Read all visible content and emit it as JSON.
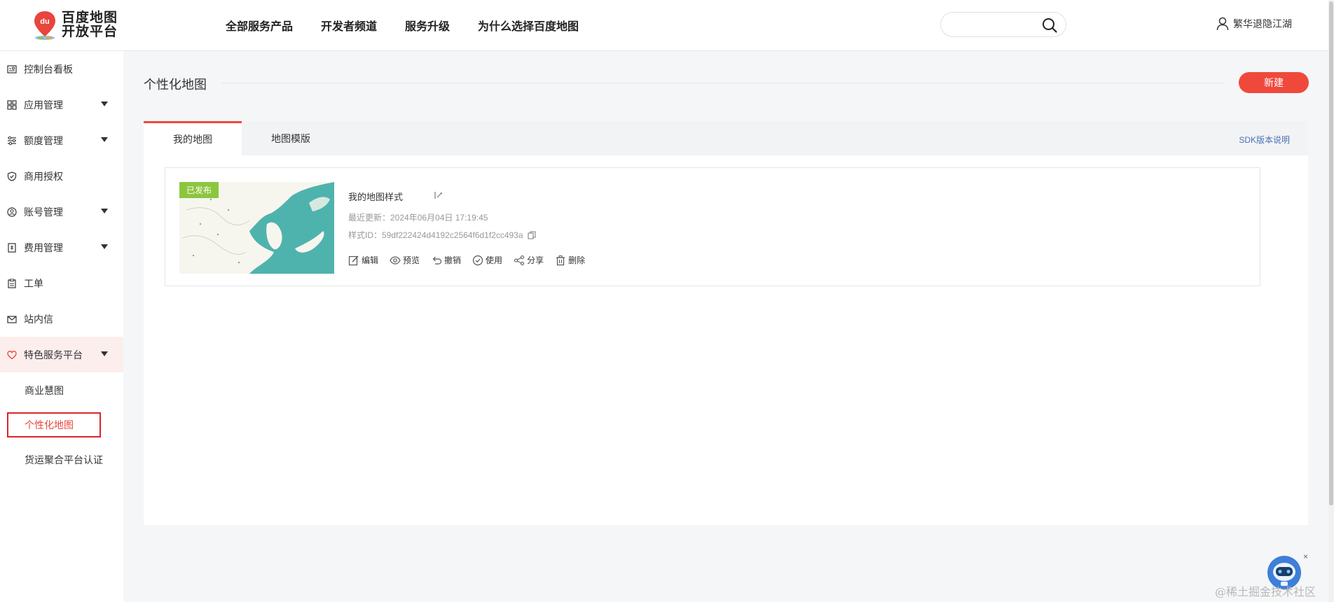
{
  "header": {
    "logo_line1": "百度地图",
    "logo_line2": "开放平台",
    "nav": [
      "全部服务产品",
      "开发者频道",
      "服务升级",
      "为什么选择百度地图"
    ],
    "search_placeholder": "",
    "username": "繁华退隐江湖"
  },
  "sidebar": {
    "items": [
      {
        "label": "控制台看板",
        "icon": "dashboard-icon",
        "has_caret": false
      },
      {
        "label": "应用管理",
        "icon": "grid-icon",
        "has_caret": true
      },
      {
        "label": "额度管理",
        "icon": "sliders-icon",
        "has_caret": true
      },
      {
        "label": "商用授权",
        "icon": "shield-check-icon",
        "has_caret": false
      },
      {
        "label": "账号管理",
        "icon": "user-circle-icon",
        "has_caret": true
      },
      {
        "label": "费用管理",
        "icon": "bill-icon",
        "has_caret": true
      },
      {
        "label": "工单",
        "icon": "clipboard-icon",
        "has_caret": false
      },
      {
        "label": "站内信",
        "icon": "mail-icon",
        "has_caret": false
      },
      {
        "label": "特色服务平台",
        "icon": "heart-icon",
        "has_caret": true
      }
    ],
    "sub_items": [
      "商业慧图",
      "个性化地图",
      "货运聚合平台认证"
    ],
    "active_color": "#e8453c"
  },
  "main": {
    "title": "个性化地图",
    "new_button": "新建",
    "tabs": [
      "我的地图",
      "地图模版"
    ],
    "sdk_link": "SDK版本说明",
    "card": {
      "badge": "已发布",
      "name": "我的地图样式",
      "updated": "最近更新：2024年06月04日 17:19:45",
      "style_id": "样式ID：59df222424d4192c2564f6d1f2cc493a",
      "actions": [
        "编辑",
        "预览",
        "撤销",
        "使用",
        "分享",
        "删除"
      ]
    }
  },
  "watermark": "@稀土掘金技术社区",
  "close_glyph": "×",
  "colors": {
    "accent": "#f0493c",
    "badge": "#8cc63f",
    "sea": "#4fb3ad",
    "link": "#4a6fb5"
  }
}
